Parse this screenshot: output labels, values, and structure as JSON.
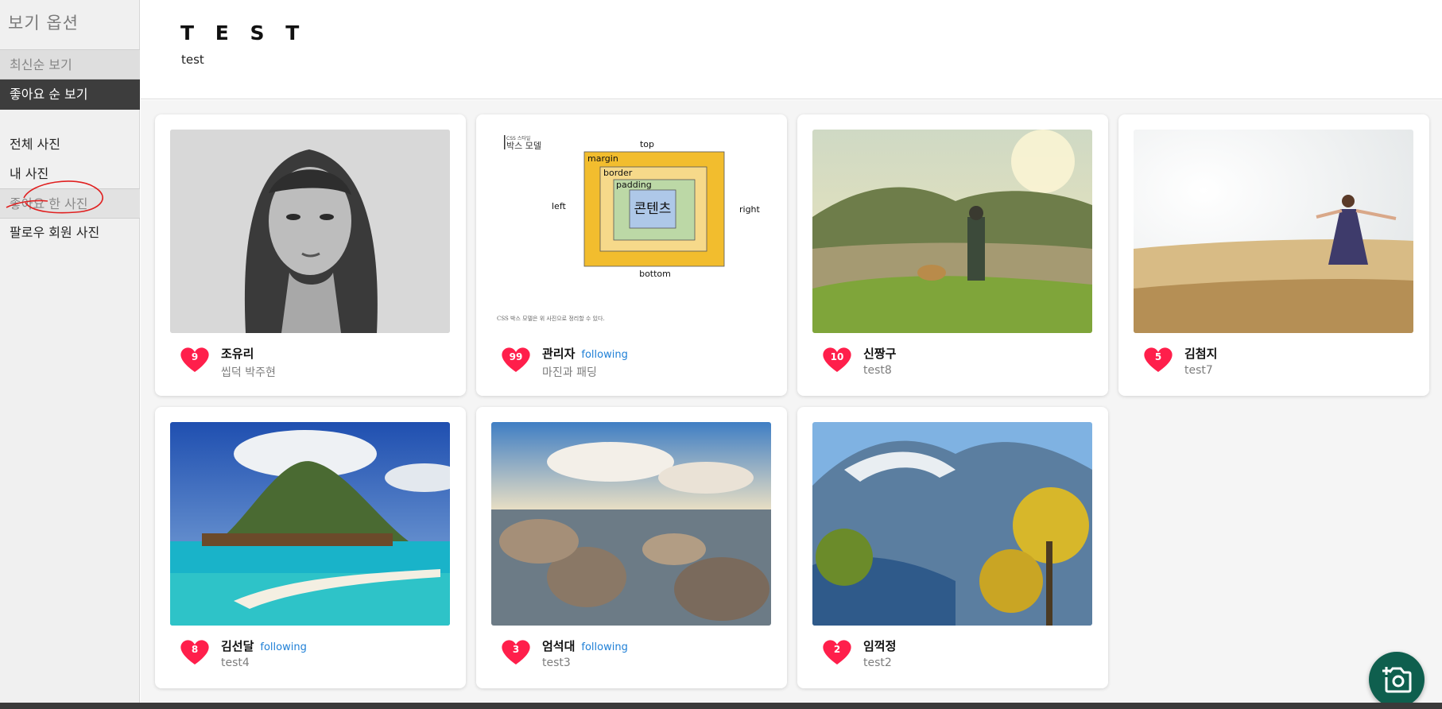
{
  "sidebar": {
    "title": "보기 옵션",
    "sort_options": [
      {
        "label": "최신순 보기",
        "active": false
      },
      {
        "label": "좋아요 순 보기",
        "active": true
      }
    ],
    "filters": [
      {
        "label": "전체 사진"
      },
      {
        "label": "내 사진"
      },
      {
        "label": "좋아요 한 사진"
      },
      {
        "label": "팔로우 회원 사진"
      }
    ]
  },
  "header": {
    "title": "T E S T",
    "subtitle": "test"
  },
  "following_label": "following",
  "cards": [
    {
      "likes": "9",
      "user": "조유리",
      "following": false,
      "caption": "씹덕 박주현",
      "image": "pencil-portrait"
    },
    {
      "likes": "99",
      "user": "관리자",
      "following": true,
      "caption": "마진과 패딩",
      "image": "css-box-model-diagram"
    },
    {
      "likes": "10",
      "user": "신짱구",
      "following": false,
      "caption": "test8",
      "image": "hiker-with-dog-lake"
    },
    {
      "likes": "5",
      "user": "김첨지",
      "following": false,
      "caption": "test7",
      "image": "girl-in-wheat-field"
    },
    {
      "likes": "8",
      "user": "김선달",
      "following": true,
      "caption": "test4",
      "image": "tropical-island-bungalows"
    },
    {
      "likes": "3",
      "user": "엄석대",
      "following": true,
      "caption": "test3",
      "image": "rocks-at-sunset-beach"
    },
    {
      "likes": "2",
      "user": "임꺽정",
      "following": false,
      "caption": "test2",
      "image": "mountain-with-autumn-trees"
    }
  ],
  "diagram": {
    "heading_small": "CSS 스타일",
    "heading": "박스 모델",
    "top": "top",
    "bottom": "bottom",
    "left": "left",
    "right": "right",
    "margin": "margin",
    "border": "border",
    "padding": "padding",
    "content": "콘텐츠",
    "footnote": "CSS 박스 모델은 위 사진으로 정리할 수 있다."
  },
  "colors": {
    "like_heart": "#ff1f4b",
    "fab": "#0f5f4e",
    "following": "#1e7fd6",
    "active_sort_bg": "#3d3d3d"
  },
  "fab_icon": "add-photo-icon"
}
